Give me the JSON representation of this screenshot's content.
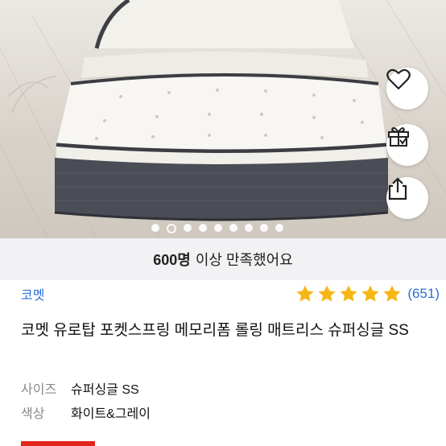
{
  "hero": {
    "carousel": {
      "total": 9,
      "active_index": 1
    }
  },
  "actions": {
    "like_icon": "heart-icon",
    "gift_icon": "gift-icon",
    "share_icon": "share-icon"
  },
  "satisfaction": {
    "count": "600명",
    "text": "이상 만족했어요"
  },
  "product": {
    "brand": "코멧",
    "rating_stars": 5,
    "review_count": "(651)",
    "title": "코멧 유로탑 포켓스프링 메모리폼 롤링 매트리스 슈퍼싱글 SS",
    "options": [
      {
        "key": "사이즈",
        "value": "슈퍼싱글 SS"
      },
      {
        "key": "색상",
        "value": "화이트&그레이"
      }
    ]
  },
  "colors": {
    "brand_blue": "#2b6fd6",
    "star_yellow": "#f6b716",
    "accent_red": "#e1251b"
  }
}
